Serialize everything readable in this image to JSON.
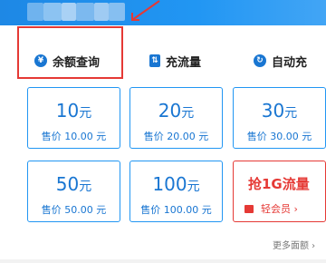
{
  "tabs": [
    {
      "label": "余额查询",
      "icon": "yen-icon"
    },
    {
      "label": "充流量",
      "icon": "flow-icon"
    },
    {
      "label": "自动充",
      "icon": "refresh-icon"
    }
  ],
  "cards": [
    {
      "amount": "10",
      "unit": "元",
      "price": "售价 10.00 元"
    },
    {
      "amount": "20",
      "unit": "元",
      "price": "售价 20.00 元"
    },
    {
      "amount": "30",
      "unit": "元",
      "price": "售价 30.00 元"
    },
    {
      "amount": "50",
      "unit": "元",
      "price": "售价 50.00 元"
    },
    {
      "amount": "100",
      "unit": "元",
      "price": "售价 100.00 元"
    }
  ],
  "promo": {
    "title": "抢1G流量",
    "brand": "轻会员 ›"
  },
  "more_label": "更多面额 ›",
  "colors": {
    "accent": "#1976d2",
    "highlight": "#e53935"
  }
}
